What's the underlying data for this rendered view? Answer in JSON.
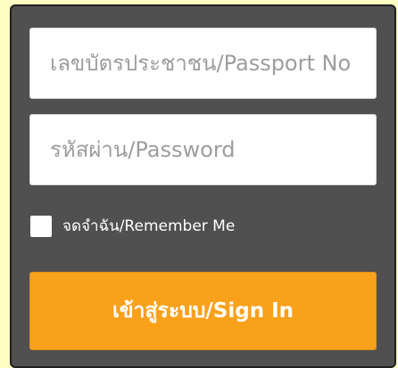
{
  "login": {
    "username_placeholder": "เลขบัตรประชาชน/Passport No",
    "password_placeholder": "รหัสผ่าน/Password",
    "remember_label": "จดจำฉัน/Remember Me",
    "signin_label": "เข้าสู่ระบบ/Sign In"
  },
  "colors": {
    "panel": "#505050",
    "button": "#f9a11b",
    "background": "#fdfdc4"
  }
}
